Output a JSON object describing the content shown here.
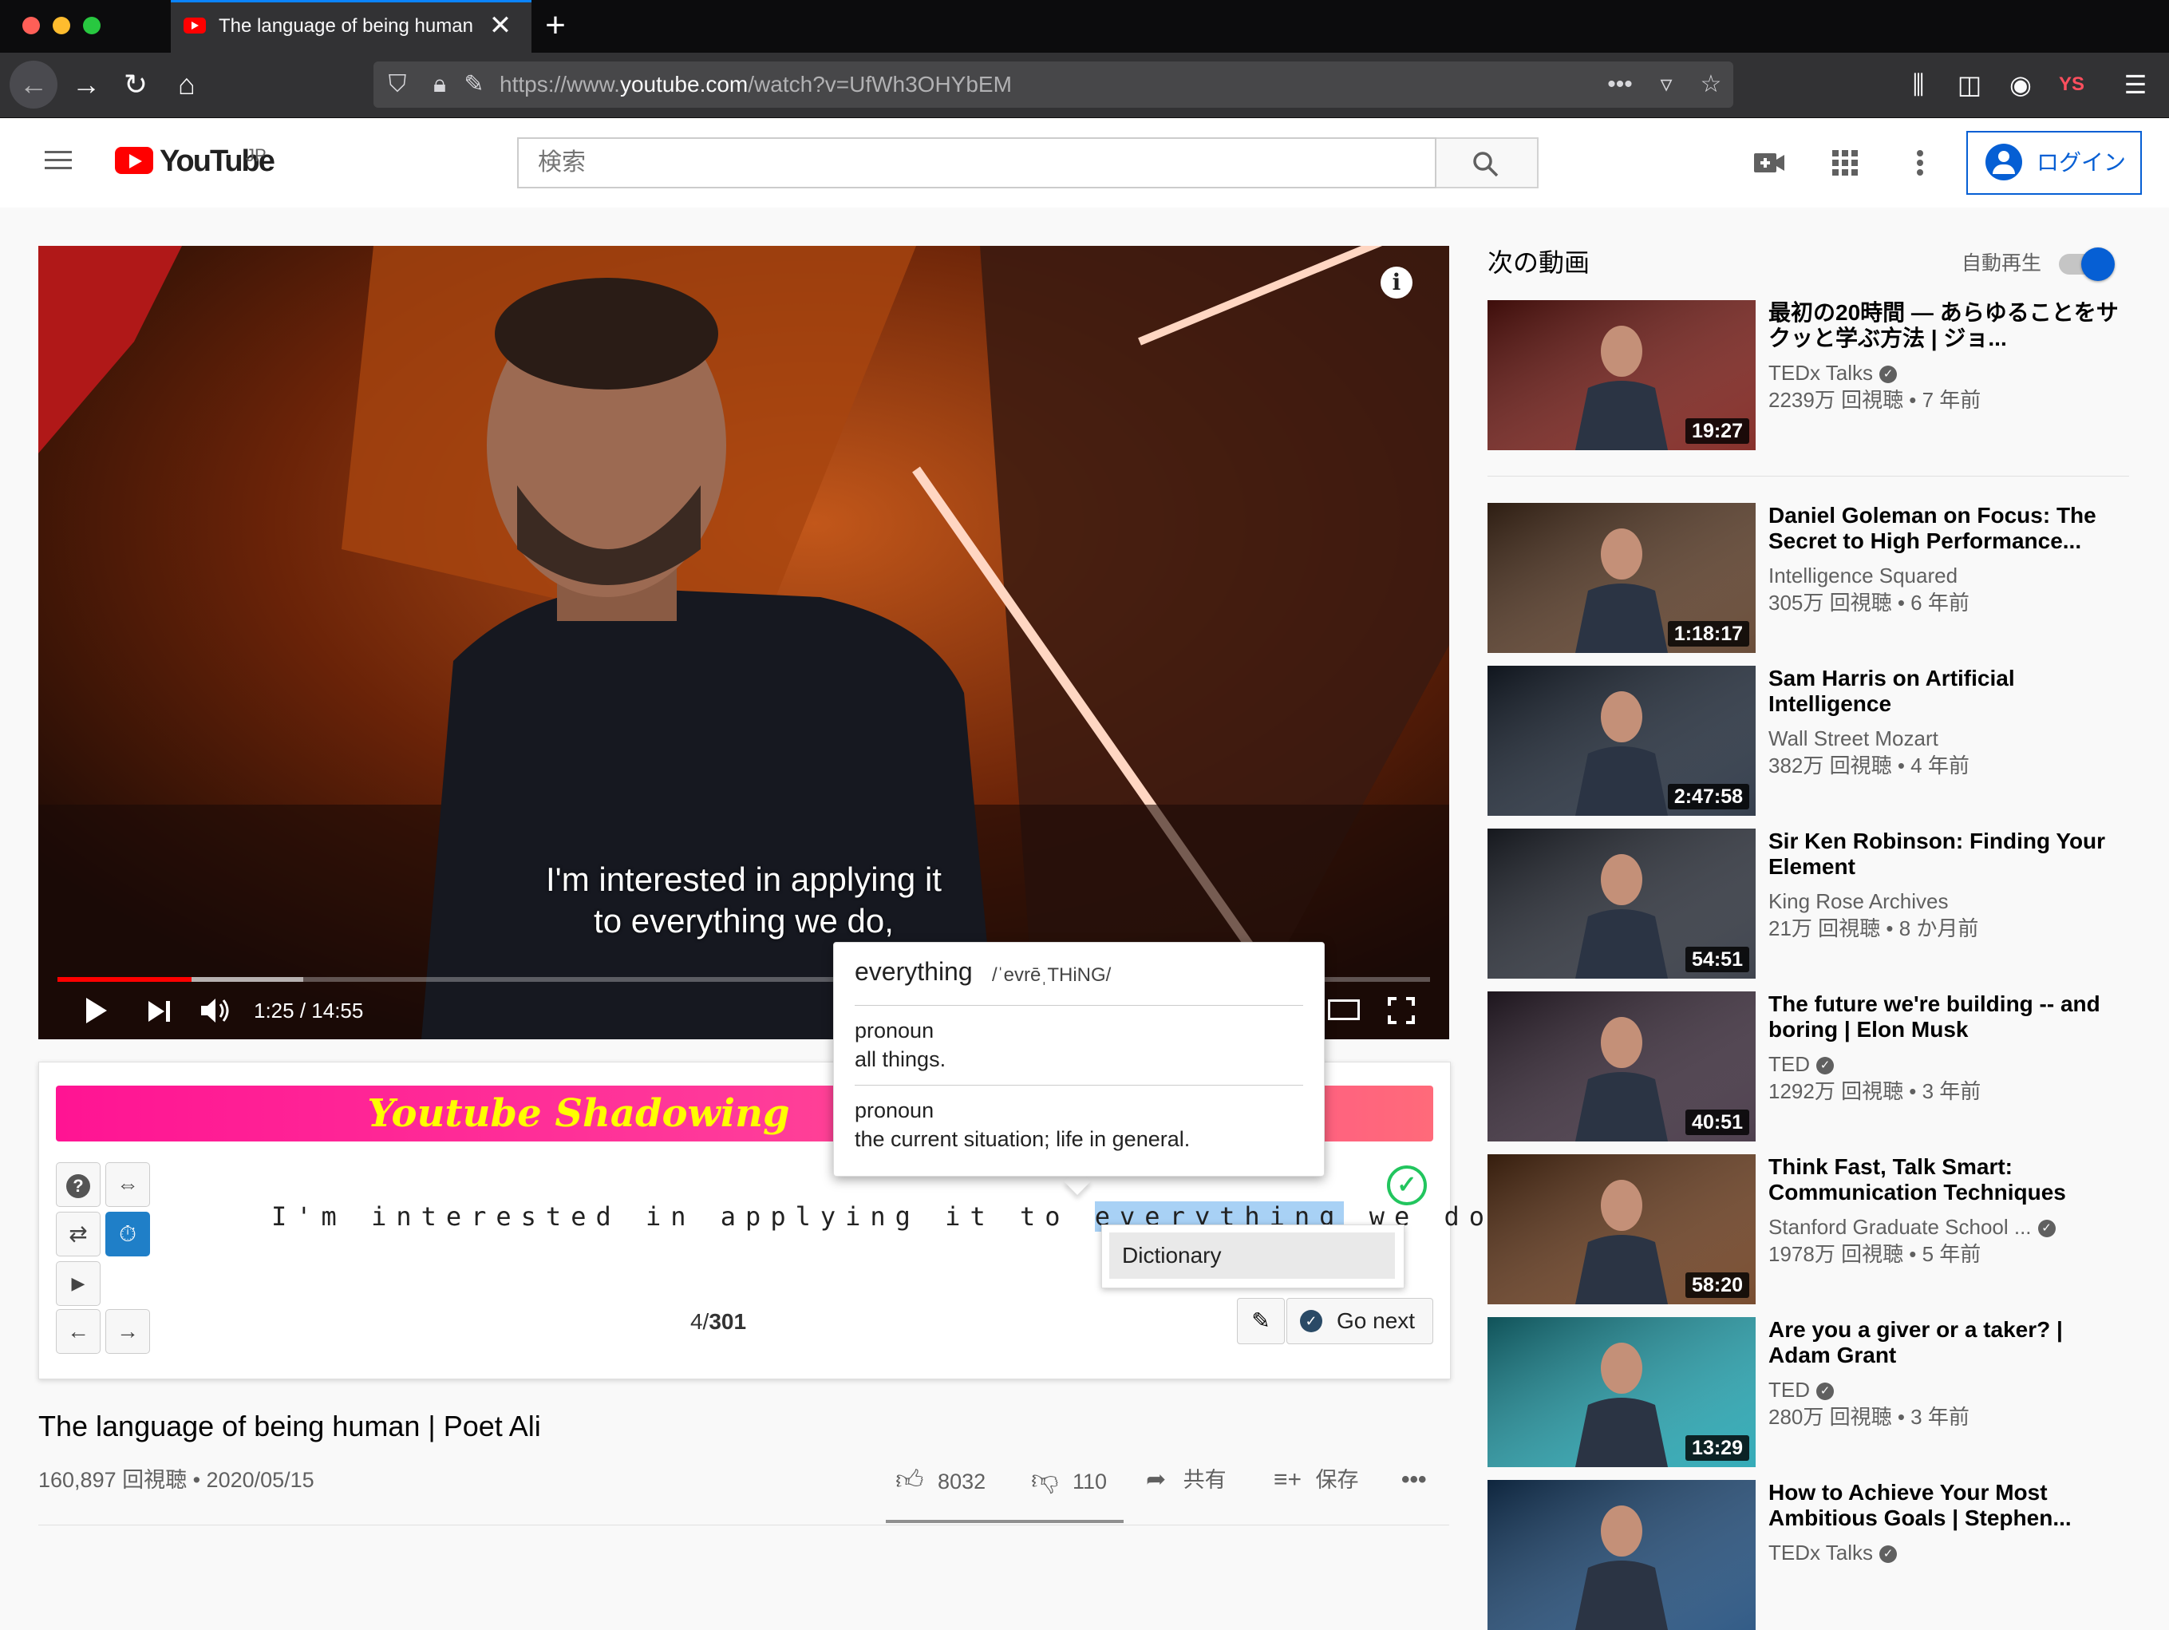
{
  "browser": {
    "tab_title": "The language of being human |",
    "url_prefix": "https://www.",
    "url_domain": "youtube.com",
    "url_path": "/watch?v=UfWh3OHYbEM",
    "profile_initials": "YS"
  },
  "youtube": {
    "wordmark": "YouTube",
    "region": "JP",
    "search_placeholder": "検索",
    "login_label": "ログイン"
  },
  "player": {
    "subtitle_line1": "I'm interested in applying it",
    "subtitle_line2": "to everything we do,",
    "time": "1:25 / 14:55",
    "progress_fraction": 0.0977,
    "buffered_fraction": 0.179
  },
  "dictionary": {
    "word": "everything",
    "phonetic": "/ˈevrēˌTHiNG/",
    "entries": [
      {
        "pos": "pronoun",
        "definition": "all things."
      },
      {
        "pos": "pronoun",
        "definition": "the current situation; life in general."
      }
    ]
  },
  "shadowing": {
    "banner_title": "Youtube Shadowing",
    "sentence_before": "I'm interested in applying it to ",
    "sentence_highlight": "everything",
    "sentence_after": " we do",
    "counter_current": "4/",
    "counter_total": "301",
    "context_menu_item": "Dictionary",
    "go_next_label": "Go next"
  },
  "video_info": {
    "title": "The language of being human | Poet Ali",
    "meta": "160,897 回視聴 • 2020/05/15",
    "likes": "8032",
    "dislikes": "110",
    "share_label": "共有",
    "save_label": "保存"
  },
  "sidebar": {
    "up_next_label": "次の動画",
    "autoplay_label": "自動再生",
    "videos": [
      {
        "title": "最初の20時間 — あらゆることをサクッと学ぶ方法 | ジョ...",
        "channel": "TEDx Talks",
        "verified": true,
        "stats": "2239万 回視聴 • 7 年前",
        "duration": "19:27",
        "thumb_color": "#7a1a14"
      },
      {
        "title": "Daniel Goleman on Focus: The Secret to High Performance...",
        "channel": "Intelligence Squared",
        "verified": false,
        "stats": "305万 回視聴 • 6 年前",
        "duration": "1:18:17",
        "thumb_color": "#5a3a24"
      },
      {
        "title": "Sam Harris on Artificial Intelligence",
        "channel": "Wall Street Mozart",
        "verified": false,
        "stats": "382万 回視聴 • 4 年前",
        "duration": "2:47:58",
        "thumb_color": "#1f2a3a"
      },
      {
        "title": "Sir Ken Robinson: Finding Your Element",
        "channel": "King Rose Archives",
        "verified": false,
        "stats": "21万 回視聴 • 8 か月前",
        "duration": "54:51",
        "thumb_color": "#2a2f3a"
      },
      {
        "title": "The future we're building -- and boring | Elon Musk",
        "channel": "TED",
        "verified": true,
        "stats": "1292万 回視聴 • 3 年前",
        "duration": "40:51",
        "thumb_color": "#3a2a3a"
      },
      {
        "title": "Think Fast, Talk Smart: Communication Techniques",
        "channel": "Stanford Graduate School ...",
        "verified": true,
        "stats": "1978万 回視聴 • 5 年前",
        "duration": "58:20",
        "thumb_color": "#6a3a1a"
      },
      {
        "title": "Are you a giver or a taker? | Adam Grant",
        "channel": "TED",
        "verified": true,
        "stats": "280万 回視聴 • 3 年前",
        "duration": "13:29",
        "thumb_color": "#1fa3b0"
      },
      {
        "title": "How to Achieve Your Most Ambitious Goals | Stephen...",
        "channel": "TEDx Talks",
        "verified": true,
        "stats": "",
        "duration": "",
        "thumb_color": "#1c4a7a"
      }
    ]
  }
}
